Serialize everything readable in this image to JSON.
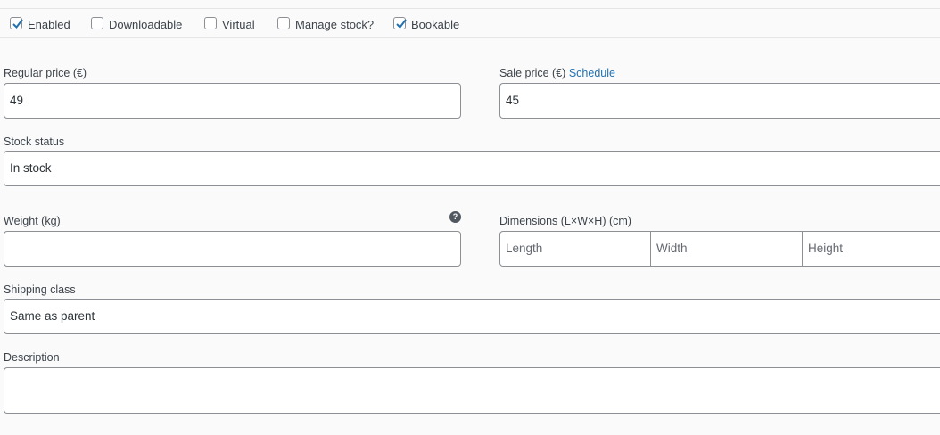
{
  "options": {
    "enabled": {
      "label": "Enabled",
      "checked": true
    },
    "downloadable": {
      "label": "Downloadable",
      "checked": false
    },
    "virtual": {
      "label": "Virtual",
      "checked": false
    },
    "manage_stock": {
      "label": "Manage stock?",
      "checked": false
    },
    "bookable": {
      "label": "Bookable",
      "checked": true
    }
  },
  "pricing": {
    "regular_label": "Regular price (€)",
    "regular_value": "49",
    "sale_label": "Sale price (€)",
    "schedule_link": "Schedule",
    "sale_value": "45"
  },
  "stock": {
    "label": "Stock status",
    "value": "In stock"
  },
  "weight": {
    "label": "Weight (kg)",
    "value": "",
    "help_icon": "question-circle-icon"
  },
  "dimensions": {
    "label": "Dimensions (L×W×H) (cm)",
    "length_placeholder": "Length",
    "width_placeholder": "Width",
    "height_placeholder": "Height"
  },
  "shipping": {
    "label": "Shipping class",
    "value": "Same as parent"
  },
  "description": {
    "label": "Description",
    "value": ""
  },
  "colors": {
    "accent": "#2271b1",
    "border": "#8c8f94",
    "text": "#3c434a",
    "background": "#fafafa"
  }
}
